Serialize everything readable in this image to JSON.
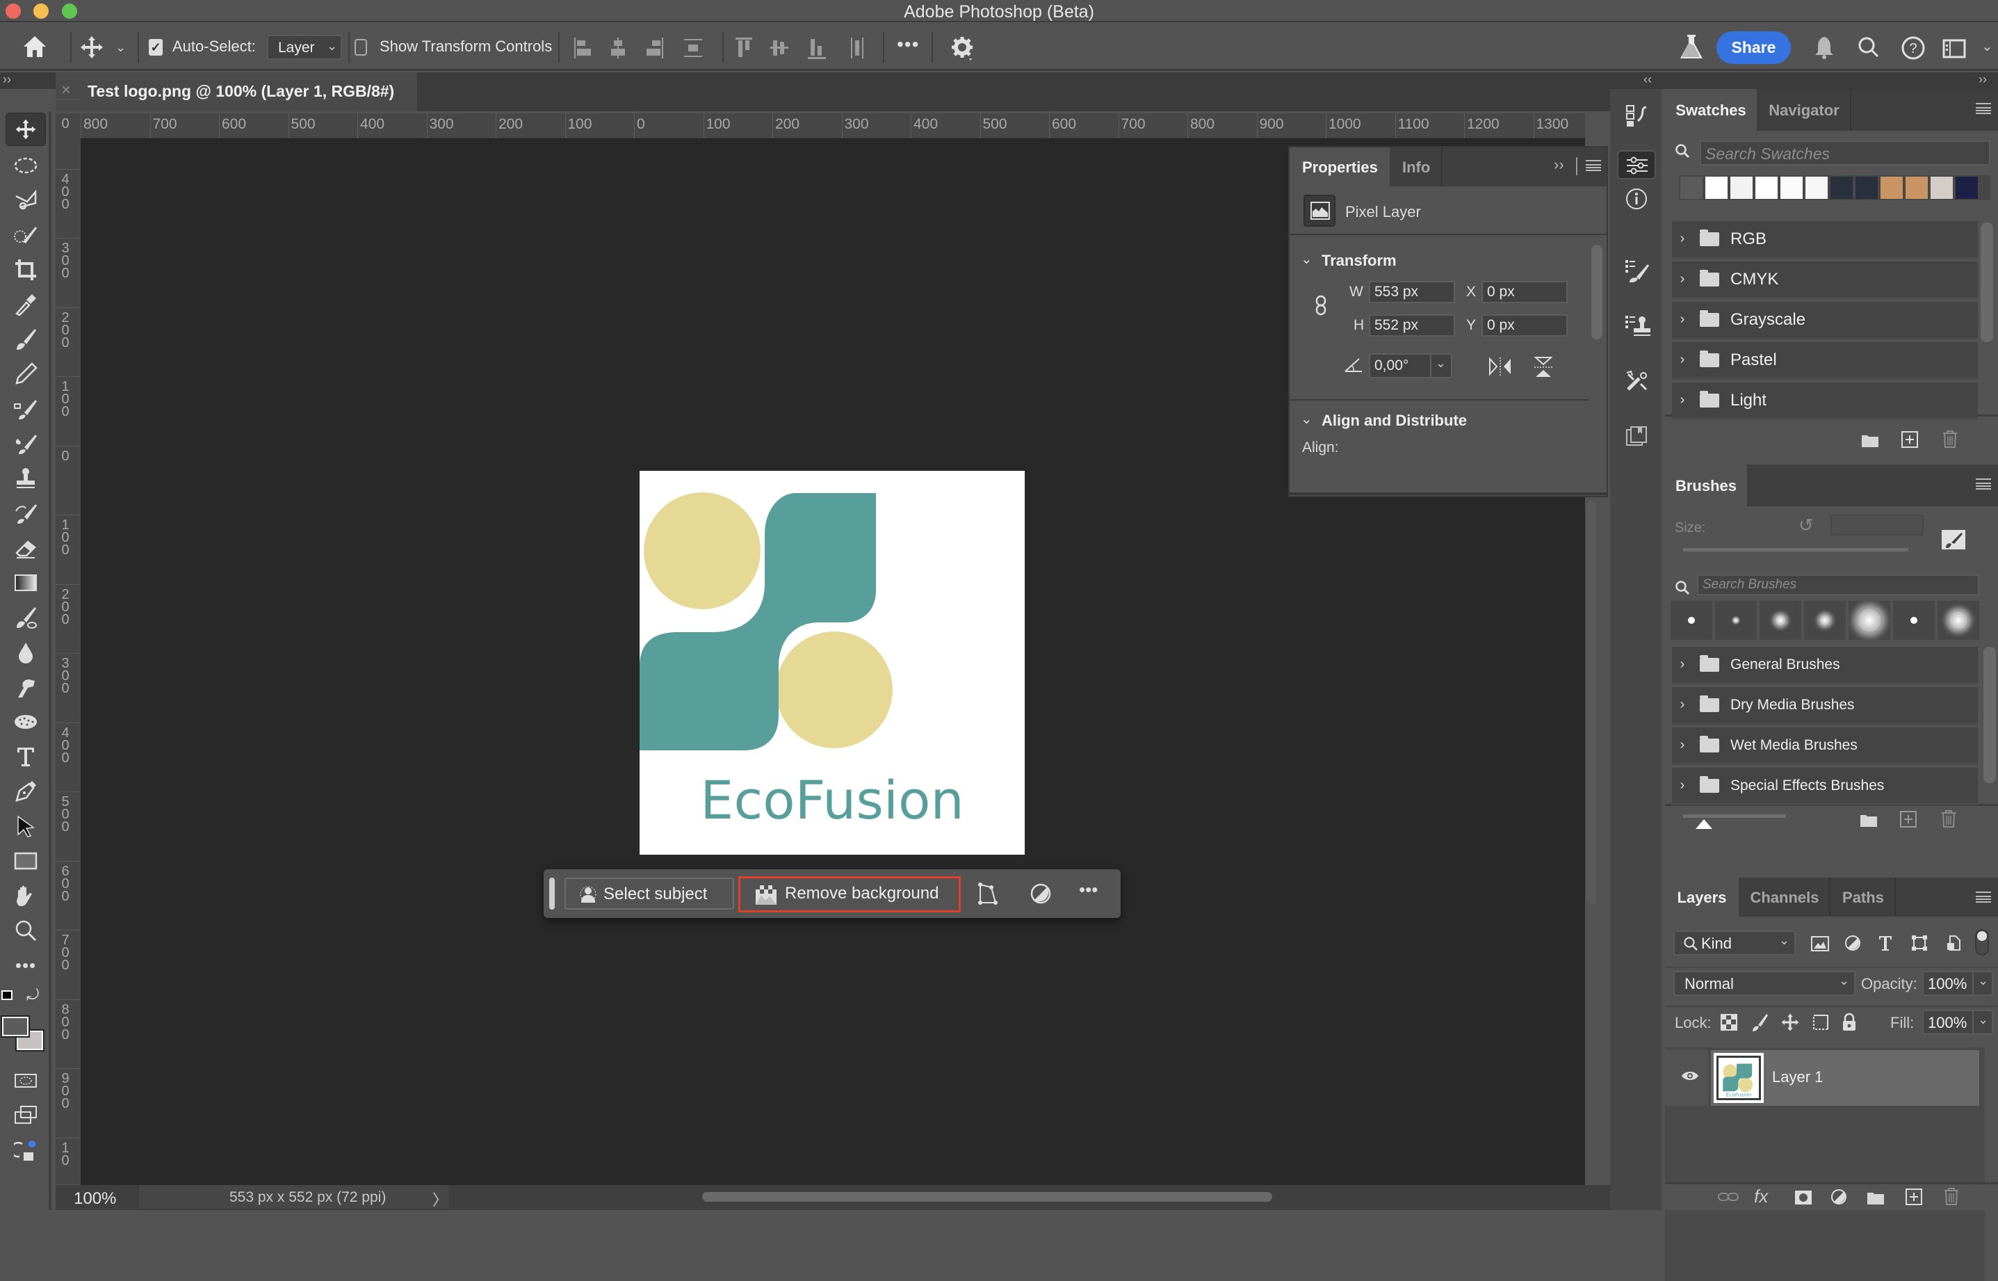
{
  "window": {
    "title": "Adobe Photoshop (Beta)",
    "traffic_lights": {
      "close": "#ee6a5e",
      "minimize": "#f5be4f",
      "maximize": "#61c554"
    }
  },
  "options_bar": {
    "home_icon": "home-icon",
    "move_tool_icon": "move-icon",
    "auto_select_checked": true,
    "auto_select_label": "Auto-Select:",
    "auto_select_value": "Layer",
    "show_transform_checked": false,
    "show_transform_label": "Show Transform Controls",
    "more_label": "•••",
    "share_label": "Share",
    "share_color": "#3573e0"
  },
  "document": {
    "tab_title": "Test logo.png @ 100% (Layer 1, RGB/8#)",
    "close_glyph": "×",
    "logo_text": "EcoFusion",
    "colors": {
      "teal": "#589f9c",
      "sand": "#e6d996",
      "background": "#ffffff"
    }
  },
  "ruler": {
    "top_labels": [
      "800",
      "700",
      "600",
      "500",
      "400",
      "300",
      "200",
      "100",
      "0",
      "100",
      "200",
      "300",
      "400",
      "500",
      "600",
      "700",
      "800",
      "900",
      "1000",
      "1100",
      "1200",
      "1300"
    ],
    "left_labels": [
      "0",
      "4 0 0",
      "3 0 0",
      "2 0 0",
      "1 0 0",
      "0",
      "1 0 0",
      "2 0 0",
      "3 0 0",
      "4 0 0",
      "5 0 0",
      "6 0 0",
      "7 0 0",
      "8 0 0",
      "9 0 0",
      "1 0"
    ]
  },
  "context_bar": {
    "select_subject_label": "Select subject",
    "remove_background_label": "Remove background",
    "highlight_color": "#e0402a",
    "more_label": "•••"
  },
  "status_bar": {
    "zoom": "100%",
    "doc_info": "553 px x 552 px (72 ppi)",
    "arrow": "〉"
  },
  "properties": {
    "tabs": [
      {
        "label": "Properties",
        "active": true
      },
      {
        "label": "Info",
        "active": false
      }
    ],
    "layer_type": "Pixel Layer",
    "transform_heading": "Transform",
    "w_label": "W",
    "w_value": "553 px",
    "h_label": "H",
    "h_value": "552 px",
    "x_label": "X",
    "x_value": "0 px",
    "y_label": "Y",
    "y_value": "0 px",
    "angle_value": "0,00°",
    "align_heading": "Align and Distribute",
    "align_label": "Align:"
  },
  "swatches": {
    "tabs": [
      {
        "label": "Swatches",
        "active": true
      },
      {
        "label": "Navigator",
        "active": false
      }
    ],
    "search_placeholder": "Search Swatches",
    "recent_colors": [
      "#5b5b5b",
      "#ffffff",
      "#f2f2f2",
      "#ffffff",
      "#fafafa",
      "#f6f6f6",
      "#2a2f3e",
      "#2a2f3e",
      "#c89461",
      "#c89461",
      "#d4ccc6",
      "#1c2045"
    ],
    "groups": [
      "RGB",
      "CMYK",
      "Grayscale",
      "Pastel",
      "Light"
    ]
  },
  "brushes": {
    "tab": "Brushes",
    "size_label": "Size:",
    "search_placeholder": "Search Brushes",
    "groups": [
      "General Brushes",
      "Dry Media Brushes",
      "Wet Media Brushes",
      "Special Effects Brushes"
    ]
  },
  "layers": {
    "tabs": [
      {
        "label": "Layers",
        "active": true
      },
      {
        "label": "Channels",
        "active": false
      },
      {
        "label": "Paths",
        "active": false
      }
    ],
    "filter_kind": "Kind",
    "blend_mode": "Normal",
    "opacity_label": "Opacity:",
    "opacity_value": "100%",
    "lock_label": "Lock:",
    "fill_label": "Fill:",
    "fill_value": "100%",
    "items": [
      {
        "name": "Layer 1",
        "visible": true,
        "selected": true
      }
    ]
  },
  "collapse": {
    "left": "‹‹",
    "right": "››"
  }
}
